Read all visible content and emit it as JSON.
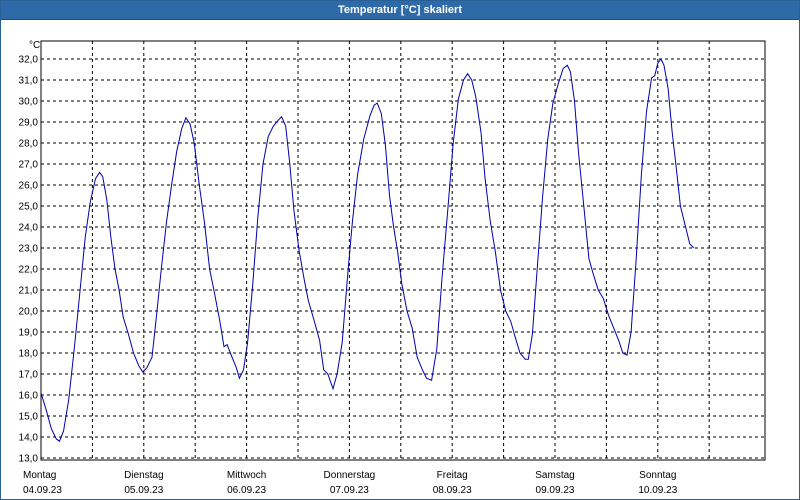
{
  "window": {
    "title": "Temperatur [°C] skaliert"
  },
  "chart_data": {
    "type": "line",
    "title": "Temperatur [°C] skaliert",
    "ylabel": "°C",
    "xlabel": "",
    "ylim": [
      13.0,
      32.5
    ],
    "yticks": [
      "13,0",
      "14,0",
      "15,0",
      "16,0",
      "17,0",
      "18,0",
      "19,0",
      "20,0",
      "21,0",
      "22,0",
      "23,0",
      "24,0",
      "25,0",
      "26,0",
      "27,0",
      "28,0",
      "29,0",
      "30,0",
      "31,0",
      "32,0"
    ],
    "x_ticks": [
      {
        "day": "Montag",
        "date": "04.09.23"
      },
      {
        "day": "Dienstag",
        "date": "05.09.23"
      },
      {
        "day": "Mittwoch",
        "date": "06.09.23"
      },
      {
        "day": "Donnerstag",
        "date": "07.09.23"
      },
      {
        "day": "Freitag",
        "date": "08.09.23"
      },
      {
        "day": "Samstag",
        "date": "09.09.23"
      },
      {
        "day": "Sonntag",
        "date": "10.09.23"
      }
    ],
    "xlim_days": [
      0,
      7
    ],
    "grid": true,
    "line_color": "#0000aa",
    "series": [
      {
        "points": [
          [
            0.0,
            16.1
          ],
          [
            0.05,
            15.3
          ],
          [
            0.1,
            14.4
          ],
          [
            0.15,
            13.9
          ],
          [
            0.18,
            13.8
          ],
          [
            0.22,
            14.3
          ],
          [
            0.27,
            15.8
          ],
          [
            0.33,
            18.5
          ],
          [
            0.38,
            21.0
          ],
          [
            0.43,
            23.5
          ],
          [
            0.48,
            25.2
          ],
          [
            0.53,
            26.3
          ],
          [
            0.57,
            26.6
          ],
          [
            0.6,
            26.4
          ],
          [
            0.64,
            25.3
          ],
          [
            0.68,
            23.5
          ],
          [
            0.72,
            22.0
          ],
          [
            0.76,
            21.0
          ],
          [
            0.8,
            19.7
          ],
          [
            0.85,
            18.9
          ],
          [
            0.9,
            18.0
          ],
          [
            0.95,
            17.4
          ],
          [
            0.99,
            17.1
          ],
          [
            1.03,
            17.3
          ],
          [
            1.08,
            17.8
          ],
          [
            1.12,
            19.6
          ],
          [
            1.17,
            22.0
          ],
          [
            1.22,
            24.2
          ],
          [
            1.27,
            26.0
          ],
          [
            1.32,
            27.6
          ],
          [
            1.37,
            28.7
          ],
          [
            1.41,
            29.2
          ],
          [
            1.45,
            28.9
          ],
          [
            1.49,
            28.0
          ],
          [
            1.54,
            26.0
          ],
          [
            1.59,
            24.2
          ],
          [
            1.64,
            22.0
          ],
          [
            1.69,
            20.8
          ],
          [
            1.74,
            19.5
          ],
          [
            1.78,
            18.3
          ],
          [
            1.81,
            18.4
          ],
          [
            1.85,
            17.9
          ],
          [
            1.9,
            17.3
          ],
          [
            1.93,
            16.8
          ],
          [
            1.97,
            17.2
          ],
          [
            2.01,
            18.5
          ],
          [
            2.06,
            21.3
          ],
          [
            2.11,
            24.5
          ],
          [
            2.16,
            27.0
          ],
          [
            2.21,
            28.3
          ],
          [
            2.26,
            28.8
          ],
          [
            2.31,
            29.1
          ],
          [
            2.34,
            29.25
          ],
          [
            2.38,
            28.8
          ],
          [
            2.42,
            27.0
          ],
          [
            2.46,
            24.8
          ],
          [
            2.51,
            22.9
          ],
          [
            2.56,
            21.5
          ],
          [
            2.6,
            20.5
          ],
          [
            2.66,
            19.5
          ],
          [
            2.71,
            18.6
          ],
          [
            2.75,
            17.2
          ],
          [
            2.79,
            17.0
          ],
          [
            2.84,
            16.3
          ],
          [
            2.88,
            17.0
          ],
          [
            2.93,
            18.5
          ],
          [
            2.98,
            21.5
          ],
          [
            3.03,
            24.3
          ],
          [
            3.08,
            26.5
          ],
          [
            3.14,
            28.2
          ],
          [
            3.2,
            29.3
          ],
          [
            3.24,
            29.8
          ],
          [
            3.27,
            29.9
          ],
          [
            3.31,
            29.4
          ],
          [
            3.35,
            27.9
          ],
          [
            3.39,
            25.5
          ],
          [
            3.43,
            24.0
          ],
          [
            3.47,
            22.8
          ],
          [
            3.51,
            21.3
          ],
          [
            3.56,
            20.0
          ],
          [
            3.61,
            19.2
          ],
          [
            3.66,
            17.8
          ],
          [
            3.71,
            17.2
          ],
          [
            3.75,
            16.8
          ],
          [
            3.8,
            16.7
          ],
          [
            3.85,
            18.2
          ],
          [
            3.9,
            21.5
          ],
          [
            3.96,
            25.0
          ],
          [
            4.01,
            28.0
          ],
          [
            4.06,
            30.1
          ],
          [
            4.11,
            31.0
          ],
          [
            4.15,
            31.3
          ],
          [
            4.19,
            31.0
          ],
          [
            4.23,
            30.2
          ],
          [
            4.28,
            28.5
          ],
          [
            4.32,
            26.3
          ],
          [
            4.37,
            24.3
          ],
          [
            4.42,
            22.8
          ],
          [
            4.47,
            21.0
          ],
          [
            4.52,
            20.0
          ],
          [
            4.57,
            19.5
          ],
          [
            4.61,
            18.8
          ],
          [
            4.66,
            18.0
          ],
          [
            4.71,
            17.7
          ],
          [
            4.74,
            17.7
          ],
          [
            4.78,
            18.9
          ],
          [
            4.83,
            22.2
          ],
          [
            4.88,
            25.5
          ],
          [
            4.93,
            28.2
          ],
          [
            4.98,
            29.9
          ],
          [
            5.03,
            30.8
          ],
          [
            5.08,
            31.55
          ],
          [
            5.12,
            31.7
          ],
          [
            5.15,
            31.4
          ],
          [
            5.19,
            30.0
          ],
          [
            5.23,
            27.5
          ],
          [
            5.28,
            25.0
          ],
          [
            5.33,
            22.5
          ],
          [
            5.37,
            21.8
          ],
          [
            5.42,
            21.0
          ],
          [
            5.47,
            20.6
          ],
          [
            5.52,
            19.8
          ],
          [
            5.57,
            19.2
          ],
          [
            5.62,
            18.6
          ],
          [
            5.66,
            18.0
          ],
          [
            5.7,
            17.9
          ],
          [
            5.74,
            19.0
          ],
          [
            5.79,
            22.5
          ],
          [
            5.84,
            26.5
          ],
          [
            5.89,
            29.5
          ],
          [
            5.94,
            31.1
          ],
          [
            5.97,
            31.2
          ],
          [
            6.0,
            31.8
          ],
          [
            6.03,
            32.0
          ],
          [
            6.06,
            31.7
          ],
          [
            6.1,
            30.6
          ],
          [
            6.14,
            28.5
          ],
          [
            6.18,
            26.8
          ],
          [
            6.22,
            25.0
          ],
          [
            6.27,
            24.0
          ],
          [
            6.31,
            23.2
          ],
          [
            6.35,
            23.0
          ]
        ]
      }
    ]
  }
}
